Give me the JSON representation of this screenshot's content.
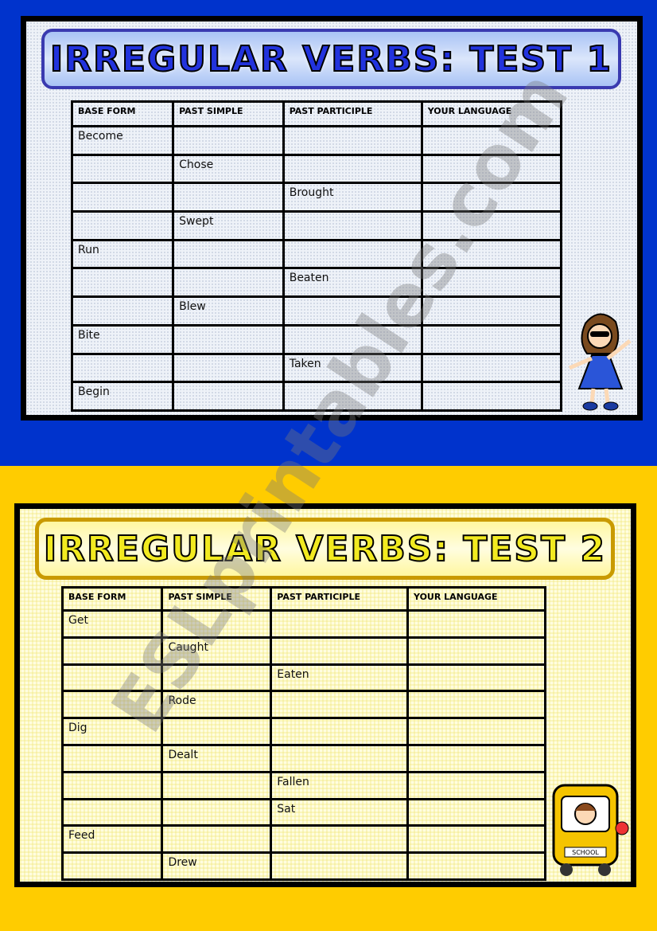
{
  "columns": [
    "BASE FORM",
    "PAST SIMPLE",
    "PAST PARTICIPLE",
    "YOUR LANGUAGE"
  ],
  "test1": {
    "title": "IRREGULAR VERBS: TEST 1",
    "accent": "#0033cc",
    "rows": [
      [
        "Become",
        "",
        "",
        ""
      ],
      [
        "",
        "Chose",
        "",
        ""
      ],
      [
        "",
        "",
        "Brought",
        ""
      ],
      [
        "",
        "Swept",
        "",
        ""
      ],
      [
        "Run",
        "",
        "",
        ""
      ],
      [
        "",
        "",
        "Beaten",
        ""
      ],
      [
        "",
        "Blew",
        "",
        ""
      ],
      [
        "Bite",
        "",
        "",
        ""
      ],
      [
        "",
        "",
        "Taken",
        ""
      ],
      [
        "Begin",
        "",
        "",
        ""
      ]
    ]
  },
  "test2": {
    "title": "IRREGULAR VERBS: TEST 2",
    "accent": "#ffcc00",
    "rows": [
      [
        "Get",
        "",
        "",
        ""
      ],
      [
        "",
        "Caught",
        "",
        ""
      ],
      [
        "",
        "",
        "Eaten",
        ""
      ],
      [
        "",
        "Rode",
        "",
        ""
      ],
      [
        "Dig",
        "",
        "",
        ""
      ],
      [
        "",
        "Dealt",
        "",
        ""
      ],
      [
        "",
        "",
        "Fallen",
        ""
      ],
      [
        "",
        "",
        "Sat",
        ""
      ],
      [
        "Feed",
        "",
        "",
        ""
      ],
      [
        "",
        "Drew",
        "",
        ""
      ]
    ]
  },
  "watermark": "ESLprintables.com",
  "bus_sign": "SCHOOL"
}
